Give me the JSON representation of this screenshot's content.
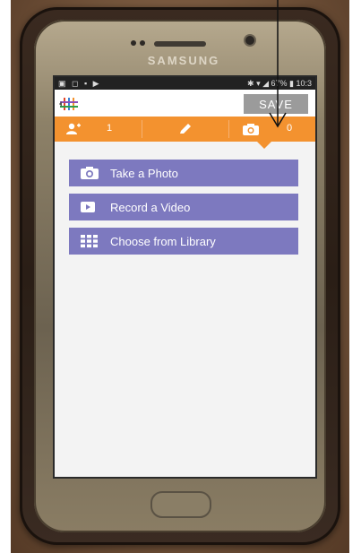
{
  "device": {
    "brand": "SAMSUNG"
  },
  "statusbar": {
    "left_icons": "▣ ◻ ▪ ▶",
    "right_text": "✱ ▾ ◢ 67% ▮ 10:3"
  },
  "appbar": {
    "save_label": "SAVE"
  },
  "tabs": {
    "people_count": "1",
    "photo_count": "0"
  },
  "menu": {
    "items": [
      {
        "label": "Take a Photo",
        "icon": "camera-icon"
      },
      {
        "label": "Record a Video",
        "icon": "video-icon"
      },
      {
        "label": "Choose from Library",
        "icon": "grid-icon"
      }
    ]
  },
  "colors": {
    "orange": "#f3922f",
    "menu_purple": "#7d79bf",
    "save_gray": "#9b9b9b"
  }
}
